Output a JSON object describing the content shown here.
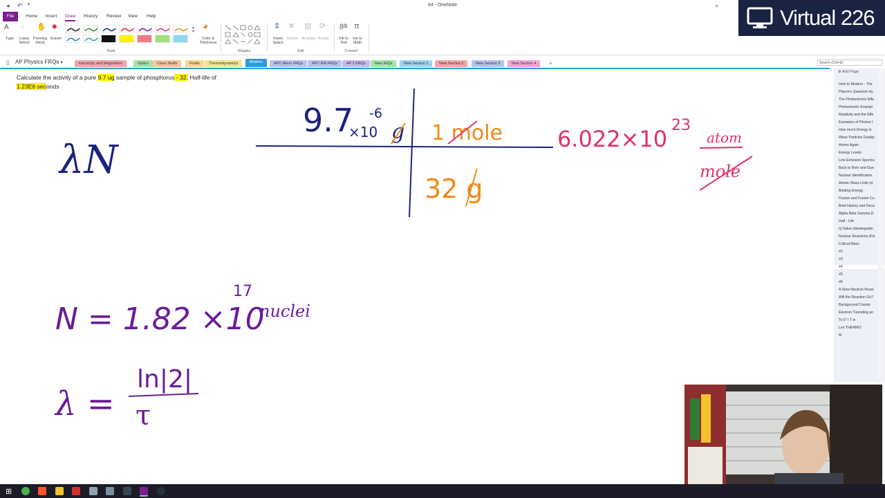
{
  "window": {
    "title": "#4 - OneNote"
  },
  "menu": [
    "File",
    "Home",
    "Insert",
    "Draw",
    "History",
    "Review",
    "View",
    "Help"
  ],
  "ribbon": {
    "tools": {
      "type": "Type",
      "lasso": "Lasso\nSelect",
      "panning": "Panning\nHand",
      "eraser": "Eraser",
      "group": "Tools",
      "color_thickness": "Color &\nThickness"
    },
    "shapes_group": "Shapes",
    "edit": {
      "insert_space": "Insert\nSpace",
      "delete": "Delete",
      "arrange": "Arrange",
      "rotate": "Rotate",
      "group": "Edit"
    },
    "convert": {
      "ink_to_text": "Ink to\nText",
      "ink_to_math": "Ink to\nMath",
      "group": "Convert"
    }
  },
  "banner": {
    "text": "Virtual 226"
  },
  "notebook": {
    "name": "AP Physics FRQs"
  },
  "sections": [
    {
      "label": "Electricity and Magnetism",
      "color": "#f4a6a6"
    },
    {
      "label": "Optics",
      "color": "#a6e3a6"
    },
    {
      "label": "Class Stuffs",
      "color": "#f6c59b"
    },
    {
      "label": "Fluids",
      "color": "#f8d88a"
    },
    {
      "label": "Thermodynamics",
      "color": "#f1e58c"
    },
    {
      "label": "Modern",
      "color": "#9fd3ef"
    },
    {
      "label": "APC Mech FRQs",
      "color": "#b9c3ef"
    },
    {
      "label": "APC EM FRQs",
      "color": "#b9c3ef"
    },
    {
      "label": "AP 2 FRQs",
      "color": "#c7b8ef"
    },
    {
      "label": "New IGQs",
      "color": "#a6e3a6"
    },
    {
      "label": "New Section 1",
      "color": "#9fd3ef"
    },
    {
      "label": "New Section 2",
      "color": "#f4a6a6"
    },
    {
      "label": "New Section 3",
      "color": "#b9c3ef"
    },
    {
      "label": "New Section 4",
      "color": "#f1a6d6"
    }
  ],
  "search": {
    "placeholder": "Search (Ctrl+E)"
  },
  "pages": {
    "add_label": "Add Page",
    "items": [
      "Intro to Modern - The",
      "Planck's Quantum Hy",
      "The Photoelectric Effe",
      "Photoelectric Exampl",
      "Relativity and the Effe",
      "Examples of Photon I",
      "How much Energy is",
      "Wave Particles Duality",
      "Atoms Again",
      "Energy Levels",
      "Line Emission Spectra",
      "Back to Bohr and Gue",
      "Nuclear Identification",
      "Atomic Mass Units (d",
      "Binding Energy",
      "Fission and Fusion Cu",
      "Brief History and Deca",
      "Alpha Beta Gamma D",
      "Half - Life",
      "Q-Value (disintegratio",
      "Nuclear Reactions (Fis",
      "Critical Mass",
      "#2",
      "#3",
      "#4",
      "#5",
      "#6",
      "A Slow Neutron React",
      "Will the Reaction Go?",
      "Background Counts",
      "Electron Tunneling an",
      "To 5\" t T in",
      "Leo THERMO",
      "M"
    ],
    "selected_index": 24
  },
  "question": {
    "part1": "Calculate the activity of a pure ",
    "mass": "9.7 ug",
    "part2": " sample of phosphorus",
    "isotope": " - 32.",
    "part3": "  Half-life of ",
    "halflife": "1.23E6 sec",
    "part4": "onds"
  },
  "ink": {
    "lambda_n": "λN",
    "mass_value": "9.7",
    "times10": "×10",
    "mass_exp": "-6",
    "mass_unit": "g",
    "mole_top": "1 mole",
    "mole_mass": "32 g",
    "avogadro": "6.022×10",
    "avogadro_exp": "23",
    "atom": "atom",
    "mole_bottom": "mole",
    "n_eq": "N = 1.82 ×10",
    "n_exp": "17",
    "nuclei": "nuclei",
    "lambda_eq": "λ =",
    "ln2": "ln|2|",
    "tau": "τ"
  },
  "colors": {
    "accent": "#7a1f8c",
    "ink_blue": "#1a237e",
    "ink_orange": "#ef8a17",
    "ink_pink": "#e0306a",
    "ink_purple": "#6a1b9a",
    "highlight": "#fff200"
  }
}
